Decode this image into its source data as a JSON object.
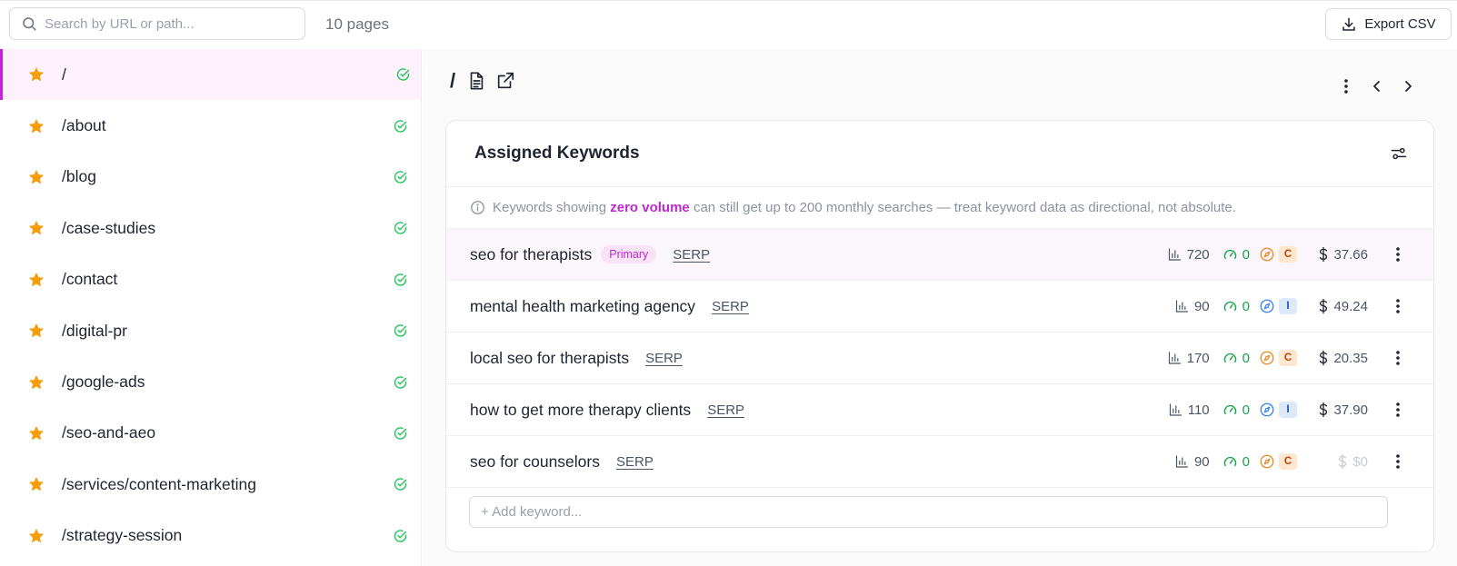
{
  "toolbar": {
    "search_placeholder": "Search by URL or path...",
    "pages_count": "10 pages",
    "export_label": "Export CSV"
  },
  "sidebar": {
    "items": [
      {
        "label": "/",
        "starred": true,
        "status": "ok",
        "active": true
      },
      {
        "label": "/about",
        "starred": true,
        "status": "ok"
      },
      {
        "label": "/blog",
        "starred": true,
        "status": "ok"
      },
      {
        "label": "/case-studies",
        "starred": true,
        "status": "ok"
      },
      {
        "label": "/contact",
        "starred": true,
        "status": "ok"
      },
      {
        "label": "/digital-pr",
        "starred": true,
        "status": "ok"
      },
      {
        "label": "/google-ads",
        "starred": true,
        "status": "ok"
      },
      {
        "label": "/seo-and-aeo",
        "starred": true,
        "status": "ok"
      },
      {
        "label": "/services/content-marketing",
        "starred": true,
        "status": "ok"
      },
      {
        "label": "/strategy-session",
        "starred": true,
        "status": "ok"
      }
    ]
  },
  "page": {
    "path": "/"
  },
  "card": {
    "title": "Assigned Keywords",
    "notice_pre": "Keywords showing",
    "notice_highlight": "zero volume",
    "notice_post": "can still get up to 200 monthly searches — treat keyword data as directional, not absolute.",
    "add_placeholder": "+ Add keyword..."
  },
  "keywords": [
    {
      "text": "seo for therapists",
      "badge": "Primary",
      "serp": "SERP",
      "volume": "720",
      "kd": "0",
      "intent": "C",
      "cpc": "37.66"
    },
    {
      "text": "mental health marketing agency",
      "serp": "SERP",
      "volume": "90",
      "kd": "0",
      "intent": "I",
      "cpc": "49.24"
    },
    {
      "text": "local seo for therapists",
      "serp": "SERP",
      "volume": "170",
      "kd": "0",
      "intent": "C",
      "cpc": "20.35"
    },
    {
      "text": "how to get more therapy clients",
      "serp": "SERP",
      "volume": "110",
      "kd": "0",
      "intent": "I",
      "cpc": "37.90"
    },
    {
      "text": "seo for counselors",
      "serp": "SERP",
      "volume": "90",
      "kd": "0",
      "intent": "C",
      "cpc": "$0"
    }
  ],
  "colors": {
    "accent": "#c026d3",
    "star": "#f59e0b",
    "ok": "#22c55e",
    "kd": "#16a34a",
    "intent_commercial": "#ea8a24",
    "intent_informational": "#3b82f6"
  },
  "icons": {
    "search": "search-icon",
    "export": "download-icon",
    "star": "star-icon",
    "status": "check-circle-icon",
    "document": "document-icon",
    "external": "external-link-icon",
    "more": "vertical-dots-icon",
    "prev": "chevron-left-icon",
    "next": "chevron-right-icon",
    "filter": "sliders-icon",
    "info": "info-icon",
    "volume": "bar-chart-icon",
    "kd": "gauge-icon",
    "intent": "compass-icon",
    "cpc": "dollar-icon"
  }
}
